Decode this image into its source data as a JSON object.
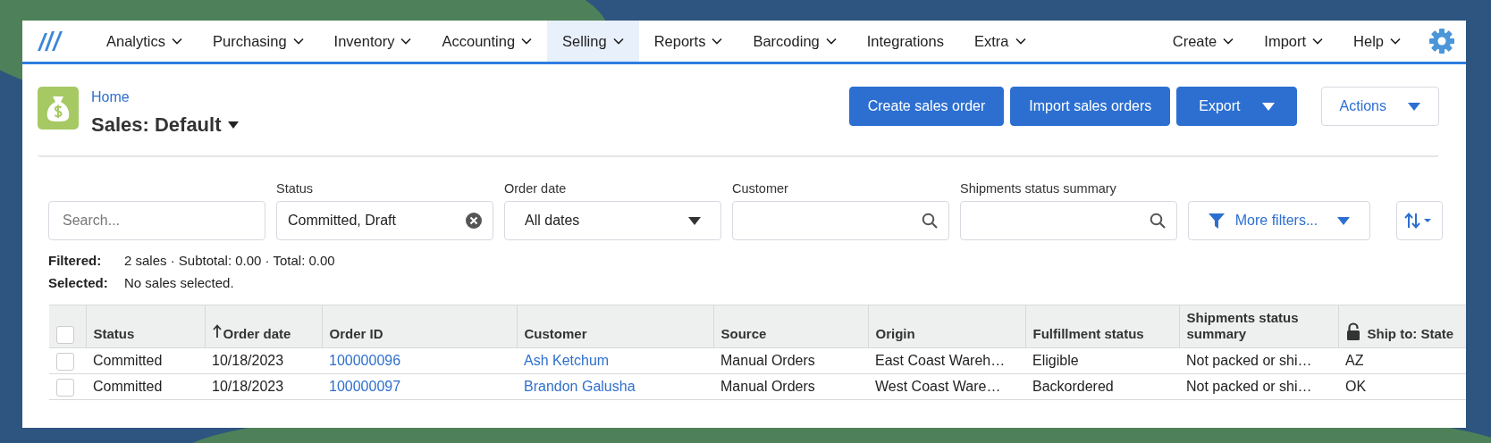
{
  "nav": {
    "items": [
      {
        "label": "Analytics",
        "dropdown": true,
        "selected": false
      },
      {
        "label": "Purchasing",
        "dropdown": true,
        "selected": false
      },
      {
        "label": "Inventory",
        "dropdown": true,
        "selected": false
      },
      {
        "label": "Accounting",
        "dropdown": true,
        "selected": false
      },
      {
        "label": "Selling",
        "dropdown": true,
        "selected": true
      },
      {
        "label": "Reports",
        "dropdown": true,
        "selected": false
      },
      {
        "label": "Barcoding",
        "dropdown": true,
        "selected": false
      },
      {
        "label": "Integrations",
        "dropdown": false,
        "selected": false
      },
      {
        "label": "Extra",
        "dropdown": true,
        "selected": false
      }
    ],
    "right_items": [
      {
        "label": "Create",
        "dropdown": true
      },
      {
        "label": "Import",
        "dropdown": true
      },
      {
        "label": "Help",
        "dropdown": true
      }
    ]
  },
  "header": {
    "breadcrumb": "Home",
    "title": "Sales: Default",
    "buttons": [
      {
        "label": "Create sales order",
        "kind": "primary"
      },
      {
        "label": "Import sales orders",
        "kind": "primary"
      },
      {
        "label": "Export",
        "kind": "primary-dropdown"
      },
      {
        "label": "Actions",
        "kind": "outline-dropdown"
      }
    ]
  },
  "filters": [
    {
      "kind": "search",
      "placeholder": "Search..."
    },
    {
      "kind": "tags",
      "label": "Status",
      "value": "Committed, Draft"
    },
    {
      "kind": "select",
      "label": "Order date",
      "value": "All dates"
    },
    {
      "kind": "lookup",
      "label": "Customer"
    },
    {
      "kind": "lookup",
      "label": "Shipments status summary"
    }
  ],
  "more_filters": "More filters...",
  "summary": [
    {
      "label": "Filtered:",
      "text": "2 sales · Subtotal: 0.00 · Total: 0.00"
    },
    {
      "label": "Selected:",
      "text": "No sales selected."
    }
  ],
  "table": {
    "all_checked": false,
    "columns": [
      {
        "label": "Status",
        "kind": "text",
        "sorted": false,
        "locked": false
      },
      {
        "label": "Order date",
        "kind": "text",
        "sorted": true,
        "locked": false
      },
      {
        "label": "Order ID",
        "kind": "link",
        "sorted": false,
        "locked": false
      },
      {
        "label": "Customer",
        "kind": "link",
        "sorted": false,
        "locked": false
      },
      {
        "label": "Source",
        "kind": "text",
        "sorted": false,
        "locked": false
      },
      {
        "label": "Origin",
        "kind": "text",
        "sorted": false,
        "locked": false
      },
      {
        "label": "Fulfillment status",
        "kind": "text",
        "sorted": false,
        "locked": false
      },
      {
        "label": "Shipments status summary",
        "kind": "text",
        "sorted": false,
        "locked": false
      },
      {
        "label": "Ship to: State",
        "kind": "text",
        "sorted": false,
        "locked": true
      }
    ],
    "rows": [
      {
        "checked": false,
        "cells": [
          "Committed",
          "10/18/2023",
          "100000096",
          "Ash Ketchum",
          "Manual Orders",
          "East Coast Wareh…",
          "Eligible",
          "Not packed or shi…",
          "AZ"
        ]
      },
      {
        "checked": false,
        "cells": [
          "Committed",
          "10/18/2023",
          "100000097",
          "Brandon Galusha",
          "Manual Orders",
          "West Coast Ware…",
          "Backordered",
          "Not packed or shi…",
          "OK"
        ]
      }
    ]
  }
}
